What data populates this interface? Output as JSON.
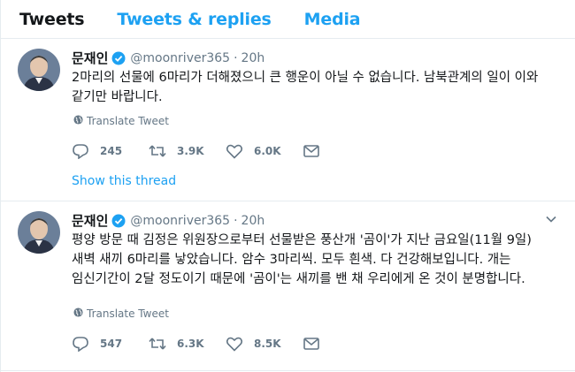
{
  "tabs": [
    {
      "label": "Tweets",
      "active": true
    },
    {
      "label": "Tweets & replies",
      "active": false
    },
    {
      "label": "Media",
      "active": false
    }
  ],
  "colors": {
    "accent": "#1da1f2",
    "muted": "#657786",
    "text": "#14171a"
  },
  "tweets": [
    {
      "name": "문재인",
      "handle": "@moonriver365",
      "time": "20h",
      "text": "2마리의 선물에 6마리가 더해졌으니 큰 행운이 아닐 수 없습니다. 남북관계의 일이 이와 같기만 바랍니다.",
      "translate": "Translate Tweet",
      "replies": "245",
      "retweets": "3.9K",
      "likes": "6.0K",
      "show_thread": "Show this thread"
    },
    {
      "name": "문재인",
      "handle": "@moonriver365",
      "time": "20h",
      "text": "평양 방문 때 김정은 위원장으로부터 선물받은 풍산개 '곰이'가 지난 금요일(11월 9일) 새벽 새끼 6마리를 낳았습니다. 암수 3마리씩. 모두 흰색. 다 건강해보입니다. 개는 임신기간이 2달 정도이기 때문에 '곰이'는 새끼를 밴 채 우리에게 온 것이 분명합니다.",
      "translate": "Translate Tweet",
      "replies": "547",
      "retweets": "6.3K",
      "likes": "8.5K"
    }
  ],
  "icons": [
    "verified-icon",
    "chevron-down-icon",
    "globe-icon",
    "reply-icon",
    "retweet-icon",
    "like-icon",
    "message-icon"
  ]
}
